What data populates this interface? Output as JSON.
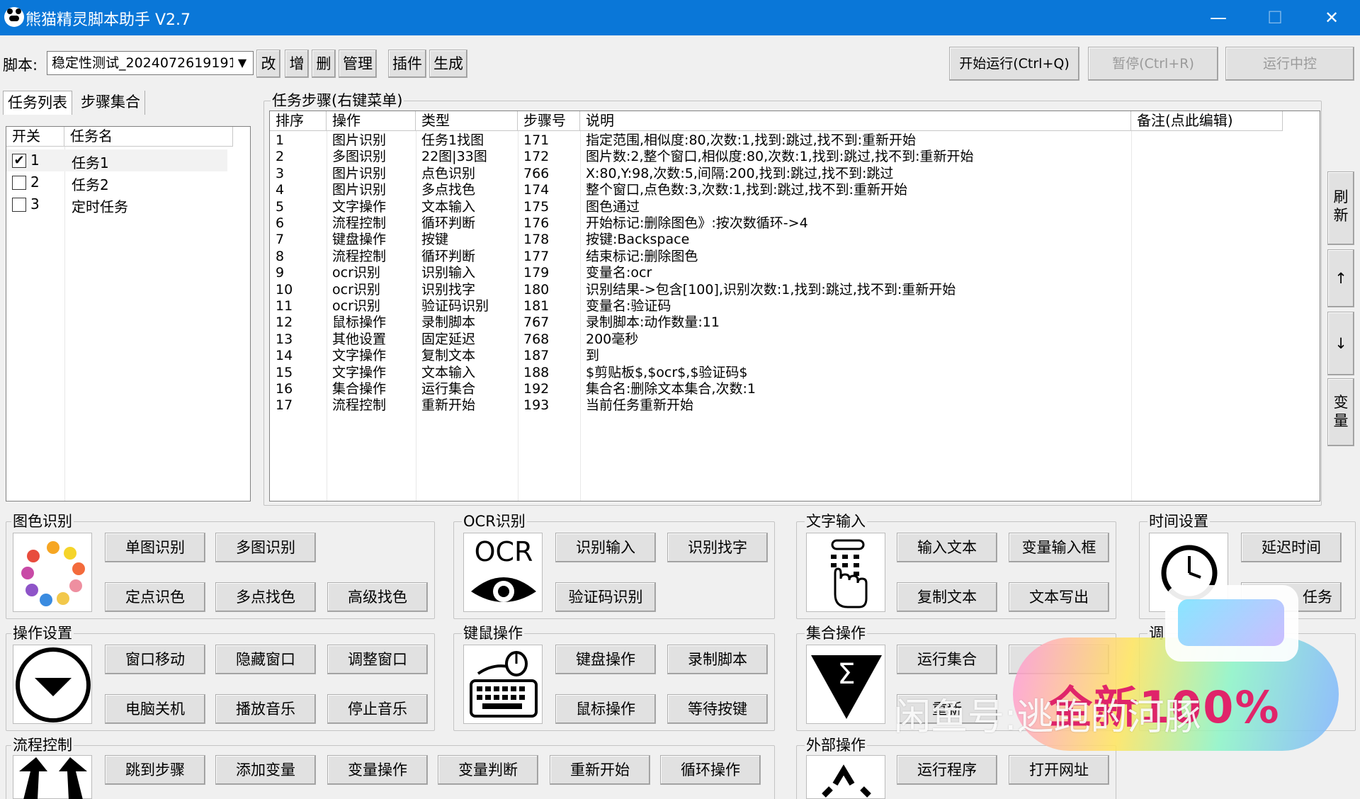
{
  "window": {
    "title": "熊猫精灵脚本助手  V2.7",
    "minimize": "—",
    "maximize": "☐",
    "close": "✕"
  },
  "toolbar": {
    "script_label": "脚本:",
    "script_value": "稳定性测试_2024072619191",
    "edit": "改",
    "add": "增",
    "delete": "删",
    "manage": "管理",
    "plugin": "插件",
    "generate": "生成",
    "start": "开始运行(Ctrl+Q)",
    "pause": "暂停(Ctrl+R)",
    "monitor": "运行中控"
  },
  "tabs": {
    "task_list": "任务列表",
    "step_set": "步骤集合"
  },
  "task_list": {
    "col_switch": "开关",
    "col_name": "任务名",
    "rows": [
      {
        "no": "1",
        "name": "任务1",
        "checked": "✔"
      },
      {
        "no": "2",
        "name": "任务2",
        "checked": ""
      },
      {
        "no": "3",
        "name": "定时任务",
        "checked": ""
      }
    ]
  },
  "steps": {
    "title": "任务步骤(右键菜单)",
    "columns": [
      "排序",
      "操作",
      "类型",
      "步骤号",
      "说明",
      "备注(点此编辑)"
    ],
    "rows": [
      [
        "1",
        "图片识别",
        "任务1找图",
        "171",
        "指定范围,相似度:80,次数:1,找到:跳过,找不到:重新开始"
      ],
      [
        "2",
        "多图识别",
        "22图|33图",
        "172",
        "图片数:2,整个窗口,相似度:80,次数:1,找到:跳过,找不到:重新开始"
      ],
      [
        "3",
        "图片识别",
        "点色识别",
        "766",
        "X:80,Y:98,次数:5,间隔:200,找到:跳过,找不到:跳过"
      ],
      [
        "4",
        "图片识别",
        "多点找色",
        "174",
        "整个窗口,点色数:3,次数:1,找到:跳过,找不到:重新开始"
      ],
      [
        "5",
        "文字操作",
        "文本输入",
        "175",
        "图色通过"
      ],
      [
        "6",
        "流程控制",
        "循环判断",
        "176",
        "开始标记:删除图色》:按次数循环->4"
      ],
      [
        "7",
        "键盘操作",
        "按键",
        "178",
        "按键:Backspace"
      ],
      [
        "8",
        "流程控制",
        "循环判断",
        "177",
        "结束标记:删除图色"
      ],
      [
        "9",
        "ocr识别",
        "识别输入",
        "179",
        "变量名:ocr"
      ],
      [
        "10",
        "ocr识别",
        "识别找字",
        "180",
        "识别结果->包含[100],识别次数:1,找到:跳过,找不到:重新开始"
      ],
      [
        "11",
        "ocr识别",
        "验证码识别",
        "181",
        "变量名:验证码"
      ],
      [
        "12",
        "鼠标操作",
        "录制脚本",
        "767",
        "录制脚本:动作数量:11"
      ],
      [
        "13",
        "其他设置",
        "固定延迟",
        "768",
        "200毫秒"
      ],
      [
        "14",
        "文字操作",
        "复制文本",
        "187",
        "到"
      ],
      [
        "15",
        "文字操作",
        "文本输入",
        "188",
        "$剪贴板$,$ocr$,$验证码$"
      ],
      [
        "16",
        "集合操作",
        "运行集合",
        "192",
        "集合名:删除文本集合,次数:1"
      ],
      [
        "17",
        "流程控制",
        "重新开始",
        "193",
        "当前任务重新开始"
      ]
    ]
  },
  "side_buttons": {
    "refresh": "刷新",
    "up": "↑",
    "down": "↓",
    "variable": "变量"
  },
  "groups": {
    "image": {
      "title": "图色识别",
      "b1": "单图识别",
      "b2": "多图识别",
      "b3": "定点识色",
      "b4": "多点找色",
      "b5": "高级找色"
    },
    "ocr": {
      "title": "OCR识别",
      "icon_text": "OCR",
      "b1": "识别输入",
      "b2": "识别找字",
      "b3": "验证码识别"
    },
    "text": {
      "title": "文字输入",
      "b1": "输入文本",
      "b2": "变量输入框",
      "b3": "复制文本",
      "b4": "文本写出"
    },
    "time": {
      "title": "时间设置",
      "b1": "延迟时间",
      "b2": "任务"
    },
    "operation": {
      "title": "操作设置",
      "b1": "窗口移动",
      "b2": "隐藏窗口",
      "b3": "调整窗口",
      "b4": "电脑关机",
      "b5": "播放音乐",
      "b6": "停止音乐"
    },
    "keymouse": {
      "title": "键鼠操作",
      "b1": "键盘操作",
      "b2": "录制脚本",
      "b3": "鼠标操作",
      "b4": "等待按键"
    },
    "collection": {
      "title": "集合操作",
      "icon_text": "Σ",
      "b1": "运行集合",
      "b2": "重新"
    },
    "other_partial": {
      "title": "调"
    },
    "flow": {
      "title": "流程控制",
      "b1": "跳到步骤",
      "b2": "添加变量",
      "b3": "变量操作",
      "b4": "变量判断",
      "b5": "重新开始",
      "b6": "循环操作"
    },
    "external": {
      "title": "外部操作",
      "b1": "运行程序",
      "b2": "打开网址"
    }
  },
  "watermark": {
    "text": "闲鱼号:逃跑的河豚",
    "badge": "全新100%",
    "logo": "闲鱼"
  }
}
